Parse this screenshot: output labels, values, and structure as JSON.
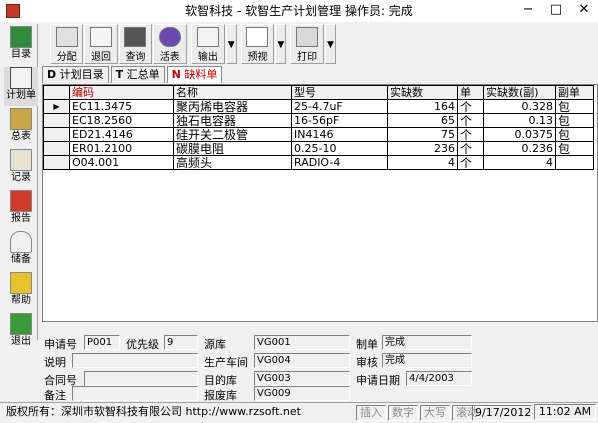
{
  "window": {
    "title": "软智科技 - 软智生产计划管理 操作员: 完成",
    "minimize": "−",
    "maximize": "□",
    "close": "✕"
  },
  "sidebar": {
    "items": [
      {
        "label": "目录",
        "icon": "book-icon"
      },
      {
        "label": "计划单",
        "icon": "plan-icon"
      },
      {
        "label": "总表",
        "icon": "summary-icon"
      },
      {
        "label": "记录",
        "icon": "record-icon"
      },
      {
        "label": "报告",
        "icon": "report-icon"
      },
      {
        "label": "储备",
        "icon": "bell-icon"
      },
      {
        "label": "帮助",
        "icon": "help-icon"
      },
      {
        "label": "退出",
        "icon": "exit-icon"
      }
    ]
  },
  "toolbar": {
    "buttons": [
      {
        "label": "分配",
        "icon": "allocate-icon"
      },
      {
        "label": "退回",
        "icon": "return-icon"
      },
      {
        "label": "查询",
        "icon": "camera-icon"
      },
      {
        "label": "活表",
        "icon": "globe-icon"
      },
      {
        "label": "输出",
        "icon": "export-icon"
      },
      {
        "label": "预视",
        "icon": "preview-icon"
      },
      {
        "label": "打印",
        "icon": "printer-icon"
      }
    ]
  },
  "tabs": [
    {
      "key": "D",
      "label": "计划目录"
    },
    {
      "key": "T",
      "label": "汇总单"
    },
    {
      "key": "N",
      "label": "缺料单"
    }
  ],
  "grid": {
    "columns": [
      "编码",
      "名称",
      "型号",
      "实缺数",
      "单",
      "实缺数(副)",
      "副单"
    ],
    "rows": [
      {
        "code": "EC11.3475",
        "name": "聚丙烯电容器",
        "model": "25-4.7uF",
        "qty": "164",
        "unit": "个",
        "qty2": "0.328",
        "unit2": "包"
      },
      {
        "code": "EC18.2560",
        "name": "独石电容器",
        "model": "16-56pF",
        "qty": "65",
        "unit": "个",
        "qty2": "0.13",
        "unit2": "包"
      },
      {
        "code": "ED21.4146",
        "name": "硅开关二极管",
        "model": "IN4146",
        "qty": "75",
        "unit": "个",
        "qty2": "0.0375",
        "unit2": "包"
      },
      {
        "code": "ER01.2100",
        "name": "碳膜电阻",
        "model": "0.25-10",
        "qty": "236",
        "unit": "个",
        "qty2": "0.236",
        "unit2": "包"
      },
      {
        "code": "O04.001",
        "name": "高频头",
        "model": "RADIO-4",
        "qty": "4",
        "unit": "个",
        "qty2": "4",
        "unit2": ""
      }
    ]
  },
  "form": {
    "req_no_label": "申请号",
    "req_no": "P001",
    "priority_label": "优先级",
    "priority": "9",
    "source_label": "源库",
    "source": "VG001",
    "maker_label": "制单",
    "maker": "完成",
    "desc_label": "说明",
    "desc": "",
    "workshop_label": "生产车间",
    "workshop": "VG004",
    "reviewer_label": "审核",
    "reviewer": "完成",
    "contract_label": "合同号",
    "contract": "",
    "target_label": "目的库",
    "target": "VG003",
    "date_label": "申请日期",
    "date": "4/4/2003",
    "remark_label": "备注",
    "remark": "",
    "scrap_label": "报废库",
    "scrap": "VG009"
  },
  "statusbar": {
    "copyright": "版权所有：深圳市软智科技有限公司 http://www.rzsoft.net",
    "ins": "插入",
    "num": "数字",
    "caps": "大写",
    "scroll": "滚动",
    "date": "9/17/2012",
    "time": "11:02 AM"
  },
  "colors": {
    "header_highlight": "#c00000",
    "active_tab": "#c00000"
  }
}
